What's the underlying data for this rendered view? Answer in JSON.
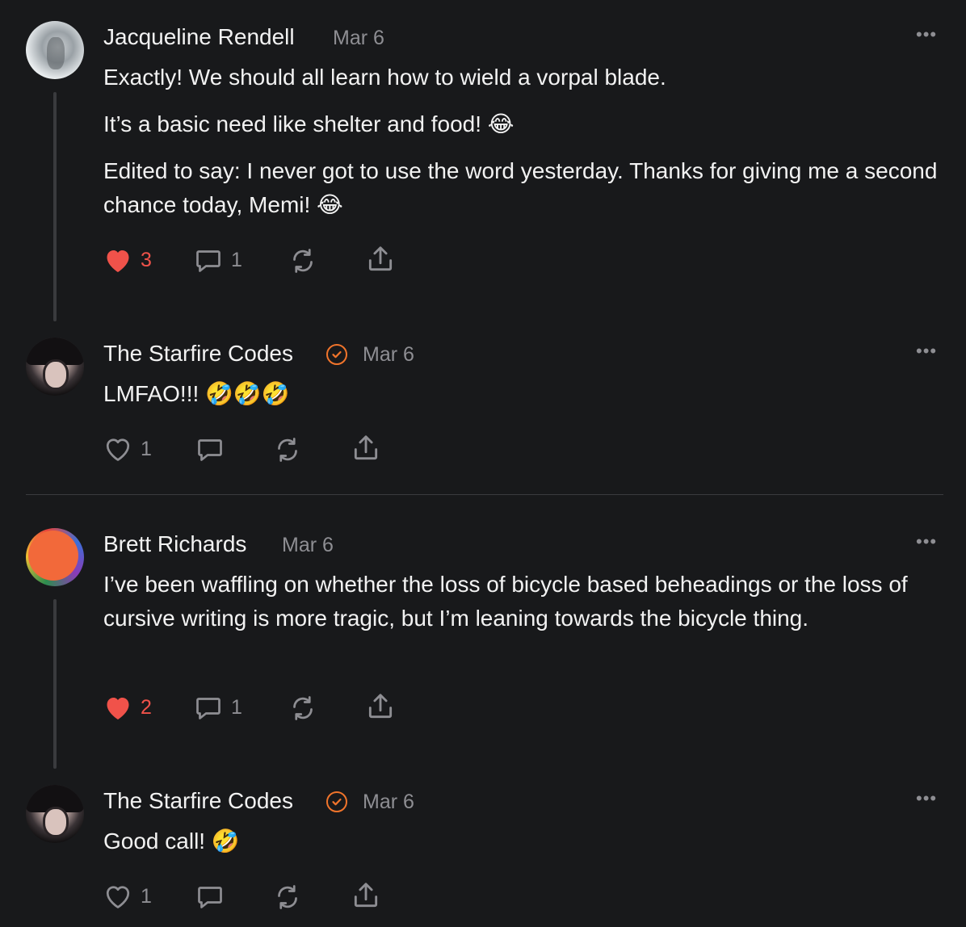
{
  "posts": [
    {
      "author": "Jacqueline Rendell",
      "date": "Mar 6",
      "verified": false,
      "paragraphs": [
        "Exactly! We should all learn how to wield a vorpal blade.",
        "It’s a basic need like shelter and food! 😂",
        "Edited to say: I never got to use the word yesterday. Thanks for giving me a second chance today, Memi! 😂"
      ],
      "likes": "3",
      "liked": true,
      "replies": "1"
    },
    {
      "author": "The Starfire Codes",
      "date": "Mar 6",
      "verified": true,
      "paragraphs": [
        "LMFAO!!! 🤣🤣🤣"
      ],
      "likes": "1",
      "liked": false,
      "replies": ""
    },
    {
      "author": "Brett Richards",
      "date": "Mar 6",
      "verified": false,
      "paragraphs": [
        "I’ve been waffling on whether the loss of bicycle based beheadings or the loss of cursive writing is more tragic, but I’m leaning towards the bicycle thing."
      ],
      "likes": "2",
      "liked": true,
      "replies": "1"
    },
    {
      "author": "The Starfire Codes",
      "date": "Mar 6",
      "verified": true,
      "paragraphs": [
        "Good call! 🤣"
      ],
      "likes": "1",
      "liked": false,
      "replies": ""
    }
  ],
  "icons": {
    "more": "more-horizontal-icon",
    "like": "heart-icon",
    "reply": "comment-icon",
    "restack": "restack-icon",
    "share": "share-icon",
    "verified": "verified-check-icon"
  },
  "colors": {
    "background": "#18191b",
    "text": "#f2f2f2",
    "muted": "#8e8e93",
    "like": "#f0524a",
    "verified": "#f0742b",
    "thread_line": "#3a3b3e"
  }
}
